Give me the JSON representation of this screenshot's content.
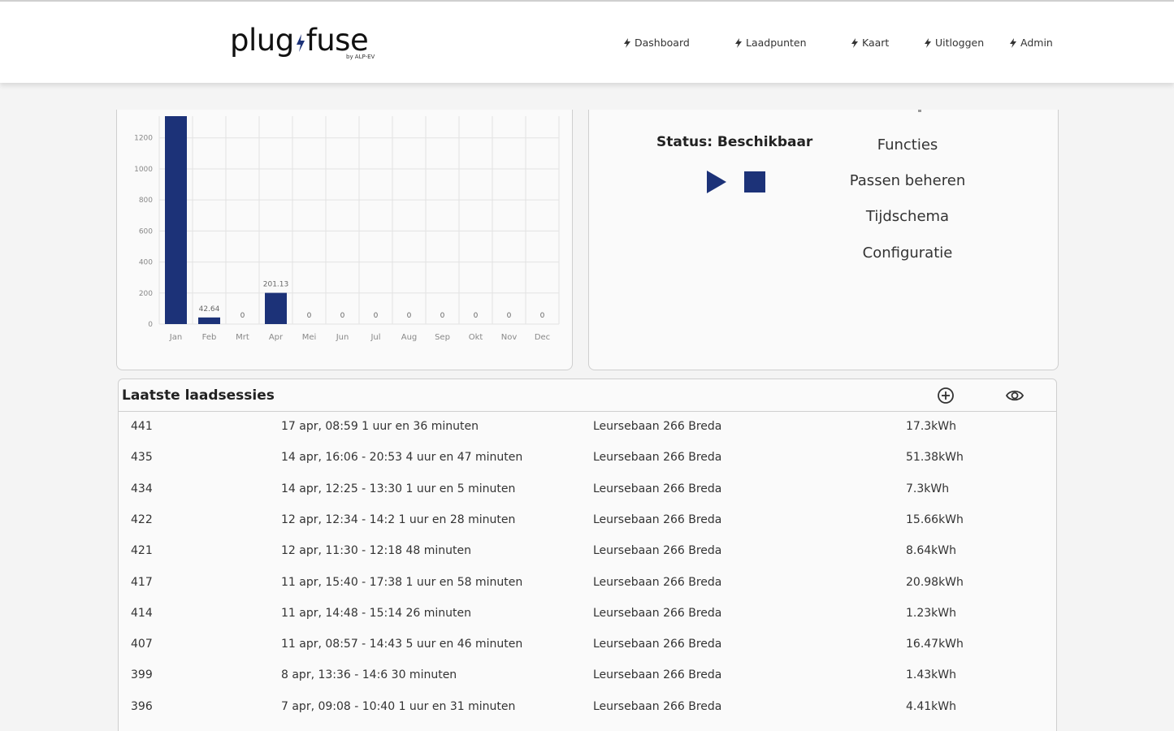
{
  "header": {
    "logo_left": "plug",
    "logo_right": "fuse",
    "logo_sub": "by ALP-EV",
    "nav": [
      {
        "label": "Dashboard",
        "icon": "bolt-icon"
      },
      {
        "label": "Laadpunten",
        "icon": "bolt-icon"
      },
      {
        "label": "Kaart",
        "icon": "bolt-icon"
      },
      {
        "label": "Uitloggen",
        "icon": "bolt-icon"
      },
      {
        "label": "Admin",
        "icon": "bolt-icon"
      }
    ]
  },
  "colors": {
    "accent": "#1c3278",
    "background": "#f4f4f4",
    "card": "#fafafa"
  },
  "chart_data": {
    "type": "bar",
    "categories": [
      "Jan",
      "Feb",
      "Mrt",
      "Apr",
      "Mei",
      "Jun",
      "Jul",
      "Aug",
      "Sep",
      "Okt",
      "Nov",
      "Dec"
    ],
    "values": [
      1340,
      42.64,
      0,
      201.13,
      0,
      0,
      0,
      0,
      0,
      0,
      0,
      0
    ],
    "value_labels": [
      "",
      "42.64",
      "0",
      "201.13",
      "0",
      "0",
      "0",
      "0",
      "0",
      "0",
      "0",
      "0"
    ],
    "yticks": [
      "0",
      "200",
      "400",
      "600",
      "800",
      "1000",
      "1200"
    ],
    "ylim": [
      0,
      1340
    ],
    "grid": true,
    "color": "#1c3278",
    "title": "",
    "xlabel": "",
    "ylabel": ""
  },
  "status": {
    "text": "Status: Beschikbaar",
    "play_icon": "play-icon",
    "stop_icon": "stop-icon",
    "functions": [
      "Functies",
      "Passen beheren",
      "Tijdschema",
      "Configuratie"
    ]
  },
  "sessions": {
    "title": "Laatste laadsessies",
    "add_icon": "plus-circle-icon",
    "view_icon": "eye-icon",
    "rows": [
      {
        "id": "441",
        "time": "17 apr, 08:59 1 uur en 36 minuten",
        "location": "Leursebaan 266 Breda",
        "energy": "17.3kWh"
      },
      {
        "id": "435",
        "time": "14 apr, 16:06 - 20:53 4 uur en 47 minuten",
        "location": "Leursebaan 266 Breda",
        "energy": "51.38kWh"
      },
      {
        "id": "434",
        "time": "14 apr, 12:25 - 13:30 1 uur en 5 minuten",
        "location": "Leursebaan 266 Breda",
        "energy": "7.3kWh"
      },
      {
        "id": "422",
        "time": "12 apr, 12:34 - 14:2 1 uur en 28 minuten",
        "location": "Leursebaan 266 Breda",
        "energy": "15.66kWh"
      },
      {
        "id": "421",
        "time": "12 apr, 11:30 - 12:18 48 minuten",
        "location": "Leursebaan 266 Breda",
        "energy": "8.64kWh"
      },
      {
        "id": "417",
        "time": "11 apr, 15:40 - 17:38 1 uur en 58 minuten",
        "location": "Leursebaan 266 Breda",
        "energy": "20.98kWh"
      },
      {
        "id": "414",
        "time": "11 apr, 14:48 - 15:14 26 minuten",
        "location": "Leursebaan 266 Breda",
        "energy": "1.23kWh"
      },
      {
        "id": "407",
        "time": "11 apr, 08:57 - 14:43 5 uur en 46 minuten",
        "location": "Leursebaan 266 Breda",
        "energy": "16.47kWh"
      },
      {
        "id": "399",
        "time": "8 apr, 13:36 - 14:6 30 minuten",
        "location": "Leursebaan 266 Breda",
        "energy": "1.43kWh"
      },
      {
        "id": "396",
        "time": "7 apr, 09:08 - 10:40 1 uur en 31 minuten",
        "location": "Leursebaan 266 Breda",
        "energy": "4.41kWh"
      }
    ]
  }
}
